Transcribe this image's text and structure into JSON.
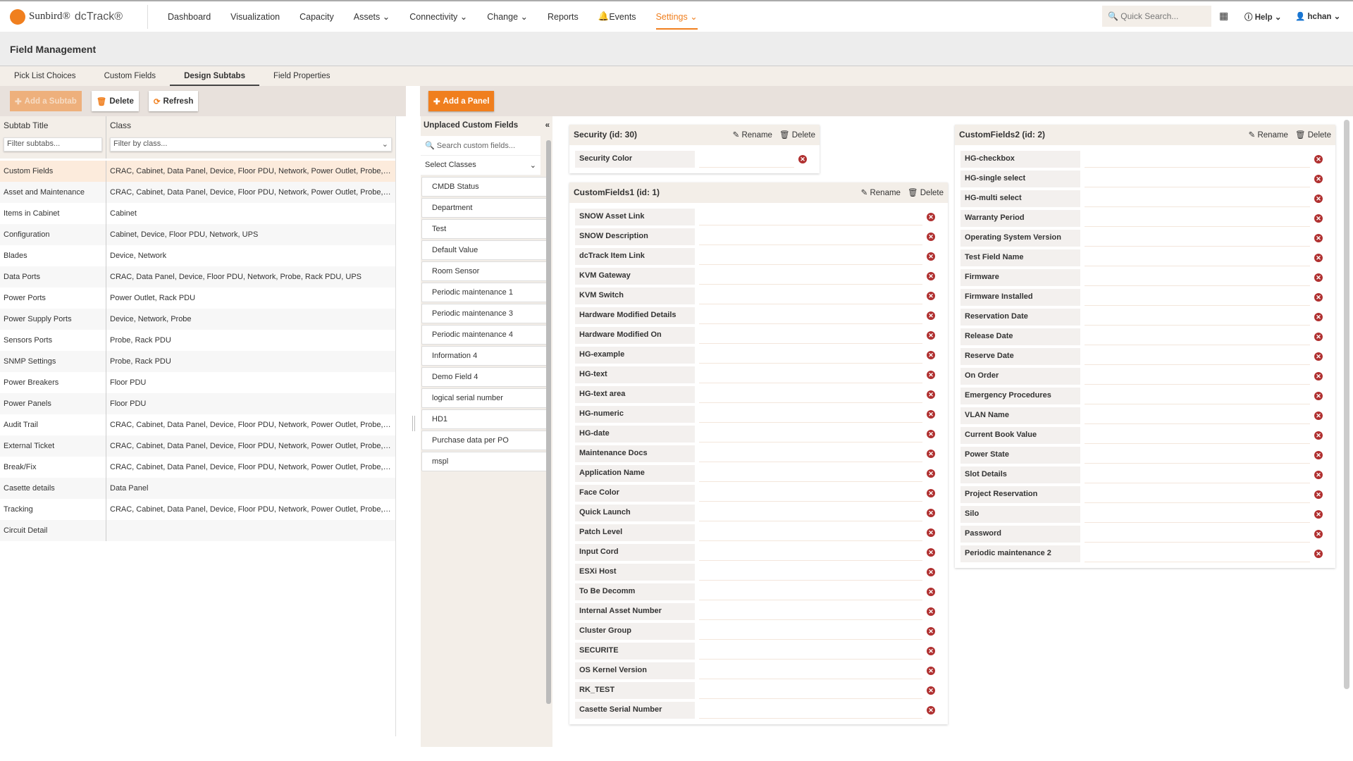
{
  "nav": {
    "brand": "Sunbird®",
    "product": "dcTrack®",
    "items": [
      "Dashboard",
      "Visualization",
      "Capacity",
      "Assets ⌄",
      "Connectivity ⌄",
      "Change ⌄",
      "Reports",
      "Events",
      "Settings ⌄"
    ],
    "active": "Settings",
    "quick_search_placeholder": "Quick Search...",
    "help": "Help ⌄",
    "user": "hchan ⌄",
    "accent": "#f07f1e"
  },
  "page_title": "Field Management",
  "tabs": [
    "Pick List Choices",
    "Custom Fields",
    "Design Subtabs",
    "Field Properties"
  ],
  "active_tab": "Design Subtabs",
  "toolbar": {
    "add_subtab": "Add a Subtab",
    "delete": "Delete",
    "refresh": "Refresh",
    "add_panel": "Add a Panel"
  },
  "subtabs": {
    "headers": [
      "Subtab Title",
      "Class"
    ],
    "filter_title_placeholder": "Filter subtabs...",
    "filter_class_placeholder": "Filter by class...",
    "rows": [
      [
        "Custom Fields",
        "CRAC, Cabinet, Data Panel, Device, Floor PDU, Network, Power Outlet, Probe, Rac..."
      ],
      [
        "Asset and Maintenance",
        "CRAC, Cabinet, Data Panel, Device, Floor PDU, Network, Power Outlet, Probe, Rac..."
      ],
      [
        "Items in Cabinet",
        "Cabinet"
      ],
      [
        "Configuration",
        "Cabinet, Device, Floor PDU, Network, UPS"
      ],
      [
        "Blades",
        "Device, Network"
      ],
      [
        "Data Ports",
        "CRAC, Data Panel, Device, Floor PDU, Network, Probe, Rack PDU, UPS"
      ],
      [
        "Power Ports",
        "Power Outlet, Rack PDU"
      ],
      [
        "Power Supply Ports",
        "Device, Network, Probe"
      ],
      [
        "Sensors Ports",
        "Probe, Rack PDU"
      ],
      [
        "SNMP Settings",
        "Probe, Rack PDU"
      ],
      [
        "Power Breakers",
        "Floor PDU"
      ],
      [
        "Power Panels",
        "Floor PDU"
      ],
      [
        "Audit Trail",
        "CRAC, Cabinet, Data Panel, Device, Floor PDU, Network, Power Outlet, Probe, Rac..."
      ],
      [
        "External Ticket",
        "CRAC, Cabinet, Data Panel, Device, Floor PDU, Network, Power Outlet, Probe, Rac..."
      ],
      [
        "Break/Fix",
        "CRAC, Cabinet, Data Panel, Device, Floor PDU, Network, Power Outlet, Probe, Rac..."
      ],
      [
        "Casette details",
        "Data Panel"
      ],
      [
        "Tracking",
        "CRAC, Cabinet, Data Panel, Device, Floor PDU, Network, Power Outlet, Probe, Rac..."
      ],
      [
        "Circuit Detail",
        ""
      ]
    ]
  },
  "unplaced": {
    "title": "Unplaced Custom Fields",
    "search_placeholder": "Search custom fields...",
    "select_classes": "Select Classes",
    "items": [
      "CMDB Status",
      "Department",
      "Test",
      "Default Value",
      "Room Sensor",
      "Periodic maintenance 1",
      "Periodic maintenance 3",
      "Periodic maintenance 4",
      "Information 4",
      "Demo Field 4",
      "logical serial number",
      "HD1",
      "Purchase data per PO",
      "mspl"
    ]
  },
  "panel_actions": {
    "rename": "Rename",
    "delete": "Delete"
  },
  "panels": [
    {
      "title": "Security (id: 30)",
      "fields": [
        "Security Color"
      ]
    },
    {
      "title": "CustomFields1 (id: 1)",
      "fields": [
        "SNOW Asset Link",
        "SNOW Description",
        "dcTrack Item Link",
        "KVM Gateway",
        "KVM Switch",
        "Hardware Modified Details",
        "Hardware Modified On",
        "HG-example",
        "HG-text",
        "HG-text area",
        "HG-numeric",
        "HG-date",
        "Maintenance Docs",
        "Application Name",
        "Face Color",
        "Quick Launch",
        "Patch Level",
        "Input Cord",
        "ESXi Host",
        "To Be Decomm",
        "Internal Asset Number",
        "Cluster Group",
        "SECURITE",
        "OS Kernel Version",
        "RK_TEST",
        "Casette Serial Number"
      ]
    },
    {
      "title": "CustomFields2 (id: 2)",
      "fields": [
        "HG-checkbox",
        "HG-single select",
        "HG-multi select",
        "Warranty Period",
        "Operating System Version",
        "Test Field Name",
        "Firmware",
        "Firmware Installed",
        "Reservation Date",
        "Release Date",
        "Reserve Date",
        "On Order",
        "Emergency Procedures",
        "VLAN Name",
        "Current Book Value",
        "Power State",
        "Slot Details",
        "Project Reservation",
        "Silo",
        "Password",
        "Periodic maintenance 2"
      ]
    }
  ]
}
